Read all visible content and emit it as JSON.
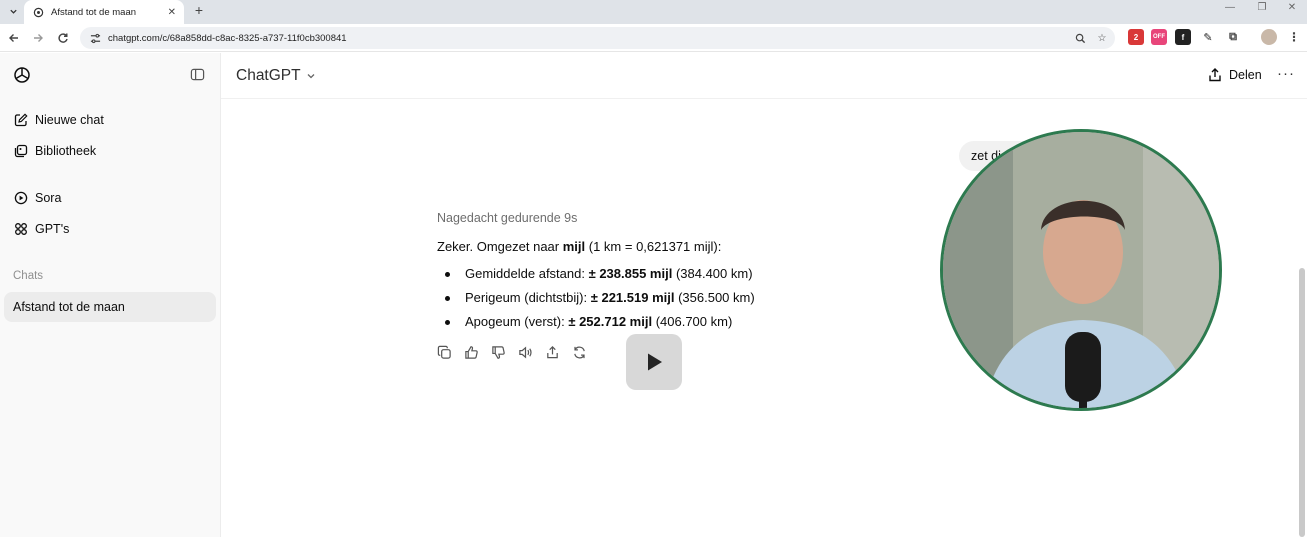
{
  "browser": {
    "tab_title": "Afstand tot de maan",
    "url": "chatgpt.com/c/68a858dd-c8ac-8325-a737-11f0cb300841",
    "extension_badge_count": "2",
    "extension_badge_off": "OFF"
  },
  "sidebar": {
    "items": [
      {
        "label": "Nieuwe chat",
        "icon": "edit-icon"
      },
      {
        "label": "Bibliotheek",
        "icon": "library-icon"
      },
      {
        "label": "Sora",
        "icon": "play-circle-icon"
      },
      {
        "label": "GPT's",
        "icon": "grid-icon"
      }
    ],
    "section_label": "Chats",
    "chats": [
      {
        "label": "Afstand tot de maan",
        "active": true
      }
    ]
  },
  "header": {
    "model": "ChatGPT",
    "share_label": "Delen",
    "more_label": "···"
  },
  "conversation": {
    "user_message": "zet di",
    "thought_label": "Nagedacht gedurende 9s",
    "answer_intro_before": "Zeker. Omgezet naar ",
    "answer_intro_bold": "mijl",
    "answer_intro_after": " (1 km = 0,621371 mijl):",
    "bullets": [
      {
        "label": "Gemiddelde afstand: ",
        "value": "± 238.855 mijl",
        "extra": " (384.400 km)"
      },
      {
        "label": "Perigeum (dichtstbij): ",
        "value": "± 221.519 mijl",
        "extra": " (356.500 km)"
      },
      {
        "label": "Apogeum (verst): ",
        "value": "± 252.712 mijl",
        "extra": " (406.700 km)"
      }
    ],
    "actions": [
      "copy-icon",
      "thumbs-up-icon",
      "thumbs-down-icon",
      "read-aloud-icon",
      "share-icon",
      "regenerate-icon"
    ]
  },
  "colors": {
    "sidebar_bg": "#f9f9f9",
    "active_item": "#ececec",
    "webcam_border": "#2d7a4f"
  }
}
